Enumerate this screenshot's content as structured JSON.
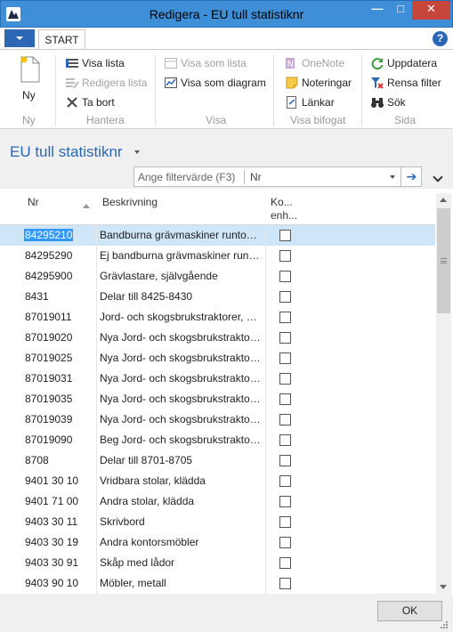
{
  "window": {
    "title": "Redigera - EU tull statistiknr"
  },
  "ribbon": {
    "tab": "START",
    "groups": {
      "ny": {
        "label": "Ny",
        "new_label": "Ny"
      },
      "hantera": {
        "label": "Hantera",
        "view_list": "Visa lista",
        "edit_list": "Redigera lista",
        "delete": "Ta bort"
      },
      "visa": {
        "label": "Visa",
        "show_as_list": "Visa som lista",
        "show_as_chart": "Visa som diagram"
      },
      "bifogat": {
        "label": "Visa bifogat",
        "onenote": "OneNote",
        "notes": "Noteringar",
        "links": "Länkar"
      },
      "sida": {
        "label": "Sida",
        "refresh": "Uppdatera",
        "clear_filter": "Rensa filter",
        "search": "Sök"
      }
    }
  },
  "page": {
    "title": "EU tull statistiknr",
    "filter": {
      "placeholder": "Ange filtervärde (F3)",
      "field": "Nr"
    }
  },
  "list": {
    "headers": {
      "nr": "Nr",
      "desc": "Beskrivning",
      "chk_line1": "Ko...",
      "chk_line2": "enh..."
    },
    "rows": [
      {
        "nr": "84295210",
        "desc": "Bandburna grävmaskiner runtomsvängbara"
      },
      {
        "nr": "84295290",
        "desc": "Ej bandburna grävmaskiner runtomsvängbara"
      },
      {
        "nr": "84295900",
        "desc": "Grävlastare, självgående"
      },
      {
        "nr": "8431",
        "desc": "Delar till 8425-8430"
      },
      {
        "nr": "87019011",
        "desc": "Jord- och skogsbrukstraktorer, ej bandtraktorer"
      },
      {
        "nr": "87019020",
        "desc": "Nya Jord- och skogsbrukstraktorer"
      },
      {
        "nr": "87019025",
        "desc": "Nya Jord- och skogsbrukstraktorer"
      },
      {
        "nr": "87019031",
        "desc": "Nya Jord- och skogsbrukstraktorer"
      },
      {
        "nr": "87019035",
        "desc": "Nya Jord- och skogsbrukstraktorer"
      },
      {
        "nr": "87019039",
        "desc": "Nya Jord- och skogsbrukstraktorer"
      },
      {
        "nr": "87019090",
        "desc": "Beg Jord- och skogsbrukstraktorer"
      },
      {
        "nr": "8708",
        "desc": "Delar till 8701-8705"
      },
      {
        "nr": "9401 30 10",
        "desc": "Vridbara stolar, klädda"
      },
      {
        "nr": "9401 71 00",
        "desc": "Andra stolar, klädda"
      },
      {
        "nr": "9403 30 11",
        "desc": "Skrivbord"
      },
      {
        "nr": "9403 30 19",
        "desc": "Andra kontorsmöbler"
      },
      {
        "nr": "9403 30 91",
        "desc": "Skåp med lådor"
      },
      {
        "nr": "9403 90 10",
        "desc": "Möbler, metall"
      }
    ]
  },
  "footer": {
    "ok": "OK"
  }
}
